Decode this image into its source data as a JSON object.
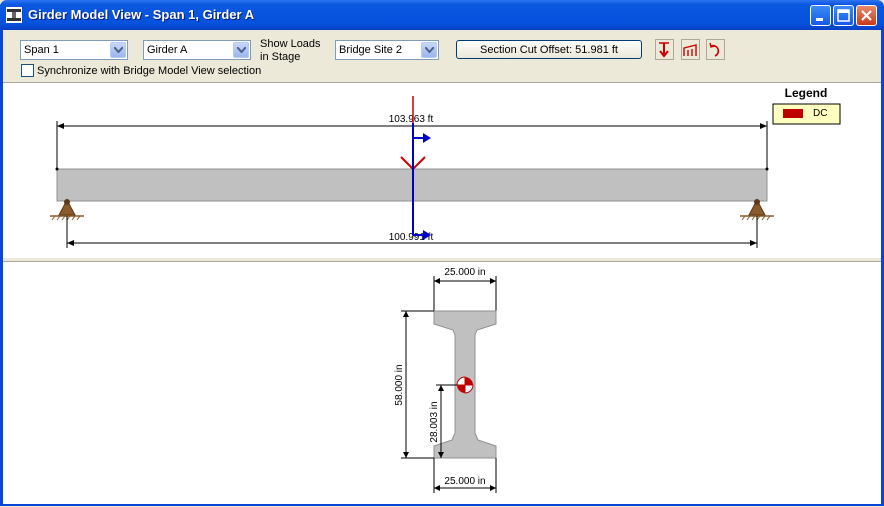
{
  "window": {
    "title": "Girder Model View - Span 1, Girder A"
  },
  "toolbar": {
    "span_value": "Span 1",
    "girder_value": "Girder A",
    "show_loads_label": "Show Loads in Stage",
    "show_loads_line1": "Show Loads",
    "show_loads_line2": "in Stage",
    "stage_value": "Bridge Site 2",
    "section_cut_label": "Section Cut Offset: 51.981 ft",
    "sync_label": "Synchronize with Bridge Model View selection",
    "sync_checked": false
  },
  "elevation": {
    "top_dim": "103.963 ft",
    "bottom_dim": "100.991 ft",
    "legend_title": "Legend",
    "legend_items": [
      {
        "label": "DC",
        "color": "#c00000"
      }
    ]
  },
  "section": {
    "top_width": "25.000 in",
    "bottom_width": "25.000 in",
    "height": "58.000 in",
    "cg_height": "28.003 in"
  },
  "colors": {
    "girder": "#c0c0c0",
    "load": "#cc0000",
    "cut": "#0000cc",
    "support": "#8b5a2b"
  }
}
